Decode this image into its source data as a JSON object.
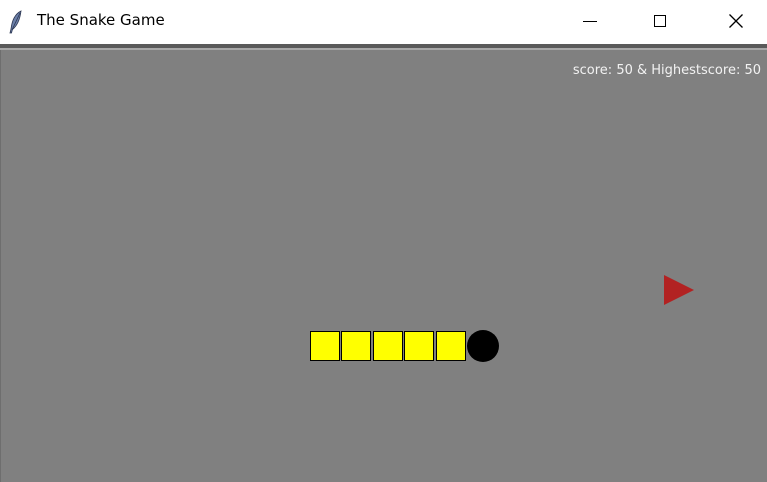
{
  "window": {
    "title": "The Snake Game",
    "icon": "feather-icon",
    "controls": [
      "minimize-icon",
      "maximize-icon",
      "close-icon"
    ]
  },
  "game": {
    "score_text": "score: 50 & Highestscore: 50",
    "score": 50,
    "highest_score": 50,
    "colors": {
      "background": "#808080",
      "snake_body": "#ffff00",
      "snake_head": "#000000",
      "food": "#b22222",
      "score_text": "#f2f2f2"
    },
    "snake_length": 6
  }
}
